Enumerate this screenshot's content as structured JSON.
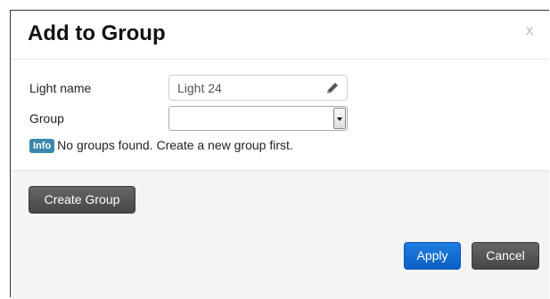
{
  "dialog": {
    "title": "Add to Group",
    "close_label": "x"
  },
  "form": {
    "light_name_label": "Light name",
    "light_name_value": "Light 24",
    "group_label": "Group",
    "group_value": "",
    "info_badge": "Info",
    "info_message": "No groups found. Create a new group first."
  },
  "footer": {
    "create_group_label": "Create Group",
    "apply_label": "Apply",
    "cancel_label": "Cancel"
  },
  "icons": {
    "edit": "pencil-icon",
    "dropdown": "chevron-down-icon"
  },
  "colors": {
    "primary": "#1670d8",
    "dark_button": "#555555",
    "info_badge": "#3a87ad",
    "footer_bg": "#f4f4f4"
  }
}
